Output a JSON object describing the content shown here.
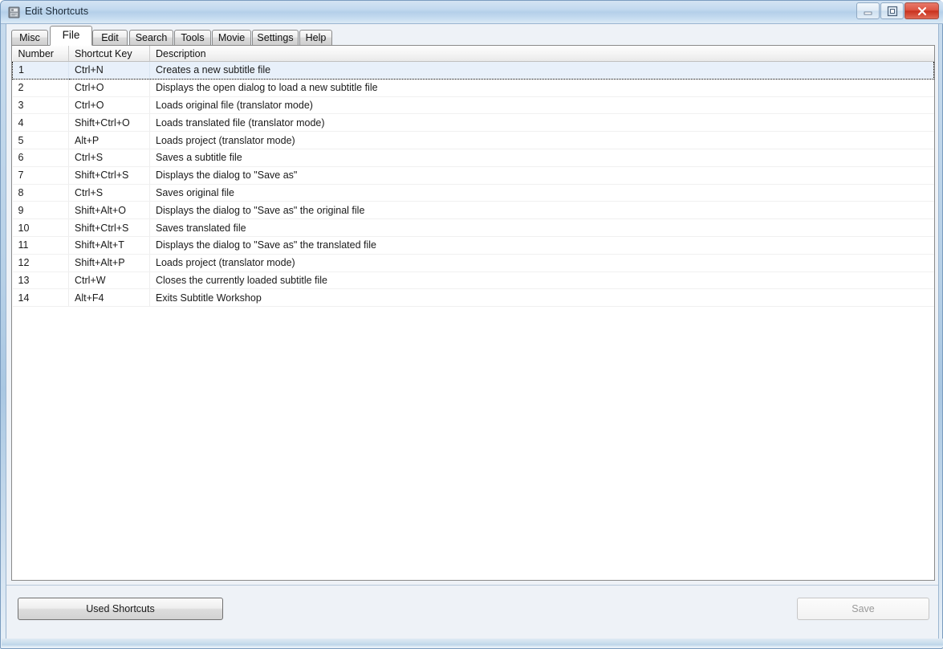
{
  "window": {
    "title": "Edit Shortcuts",
    "icon": "app-shortcuts-icon",
    "controls": {
      "minimize_label": "Minimize",
      "maximize_label": "Maximize",
      "close_label": "Close"
    },
    "accent_color": "#b4cfe9",
    "close_color": "#c9321f"
  },
  "tabs": [
    {
      "label": "Misc",
      "active": false
    },
    {
      "label": "File",
      "active": true
    },
    {
      "label": "Edit",
      "active": false
    },
    {
      "label": "Search",
      "active": false
    },
    {
      "label": "Tools",
      "active": false
    },
    {
      "label": "Movie",
      "active": false
    },
    {
      "label": "Settings",
      "active": false
    },
    {
      "label": "Help",
      "active": false
    }
  ],
  "table": {
    "columns": [
      "Number",
      "Shortcut Key",
      "Description"
    ],
    "selected_row_index": 0,
    "rows": [
      {
        "number": "1",
        "key": "Ctrl+N",
        "description": "Creates a new subtitle file"
      },
      {
        "number": "2",
        "key": "Ctrl+O",
        "description": "Displays the open dialog to load a new subtitle file"
      },
      {
        "number": "3",
        "key": "Ctrl+O",
        "description": "Loads original file (translator mode)"
      },
      {
        "number": "4",
        "key": "Shift+Ctrl+O",
        "description": "Loads translated file (translator mode)"
      },
      {
        "number": "5",
        "key": "Alt+P",
        "description": "Loads project (translator mode)"
      },
      {
        "number": "6",
        "key": "Ctrl+S",
        "description": "Saves a subtitle file"
      },
      {
        "number": "7",
        "key": "Shift+Ctrl+S",
        "description": "Displays the dialog to \"Save as\""
      },
      {
        "number": "8",
        "key": "Ctrl+S",
        "description": "Saves original file"
      },
      {
        "number": "9",
        "key": "Shift+Alt+O",
        "description": "Displays the dialog to \"Save as\" the original file"
      },
      {
        "number": "10",
        "key": "Shift+Ctrl+S",
        "description": "Saves translated file"
      },
      {
        "number": "11",
        "key": "Shift+Alt+T",
        "description": "Displays the dialog to \"Save as\" the translated file"
      },
      {
        "number": "12",
        "key": "Shift+Alt+P",
        "description": "Loads project (translator mode)"
      },
      {
        "number": "13",
        "key": "Ctrl+W",
        "description": "Closes the currently loaded subtitle file"
      },
      {
        "number": "14",
        "key": "Alt+F4",
        "description": "Exits Subtitle Workshop"
      }
    ]
  },
  "footer": {
    "used_shortcuts_label": "Used Shortcuts",
    "save_label": "Save",
    "save_enabled": false
  }
}
